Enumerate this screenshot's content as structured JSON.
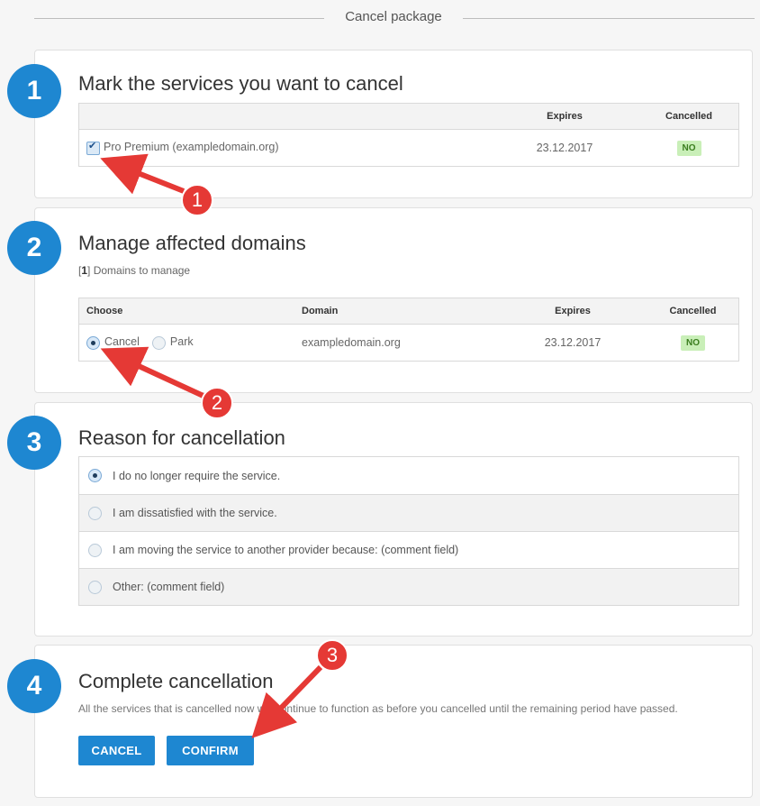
{
  "header": {
    "title": "Cancel package"
  },
  "steps": {
    "s1": {
      "number": "1",
      "title": "Mark the services you want to cancel",
      "columns": {
        "expires": "Expires",
        "cancelled": "Cancelled"
      },
      "row": {
        "service": "Pro Premium (exampledomain.org)",
        "expires": "23.12.2017",
        "cancelled": "NO",
        "checked": true
      }
    },
    "s2": {
      "number": "2",
      "title": "Manage affected domains",
      "count": "1",
      "count_suffix": "Domains to manage",
      "columns": {
        "choose": "Choose",
        "domain": "Domain",
        "expires": "Expires",
        "cancelled": "Cancelled"
      },
      "row": {
        "cancel_label": "Cancel",
        "park_label": "Park",
        "domain": "exampledomain.org",
        "expires": "23.12.2017",
        "cancelled": "NO",
        "selected": "Cancel"
      }
    },
    "s3": {
      "number": "3",
      "title": "Reason for cancellation",
      "reasons": [
        "I do no longer require the service.",
        "I am dissatisfied with the service.",
        "I am moving the service to another provider because: (comment field)",
        "Other: (comment field)"
      ],
      "selected_index": 0
    },
    "s4": {
      "number": "4",
      "title": "Complete cancellation",
      "description": "All the services that is cancelled now will continue to function as before you cancelled until the remaining period have passed.",
      "cancel_button": "CANCEL",
      "confirm_button": "CONFIRM"
    }
  },
  "annotations": {
    "m1": "1",
    "m2": "2",
    "m3": "3"
  },
  "colors": {
    "accent": "#1e87d1",
    "marker": "#e53935",
    "badge_bg": "#c9efb8"
  }
}
